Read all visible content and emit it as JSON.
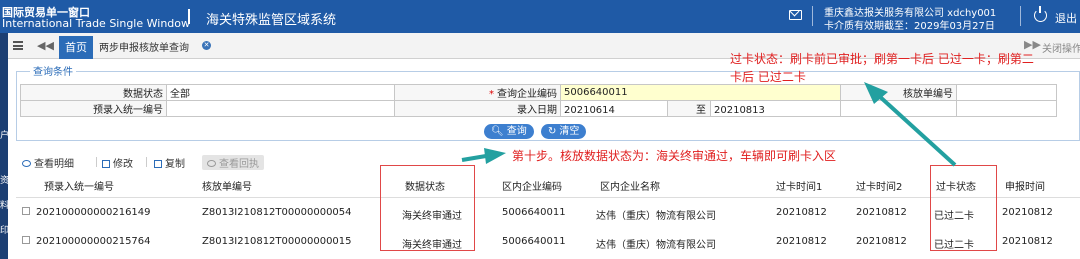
{
  "header": {
    "brand_cn": "国际贸易单一窗口",
    "brand_en": "International Trade Single Window",
    "system_title": "海关特殊监管区域系统",
    "company": "重庆鑫达报关服务有限公司 xdchy001",
    "card_validity": "卡介质有效期截至：2029年03月27日",
    "logout_label": "退出",
    "color_primary": "#1f5aa6"
  },
  "left_strip": {
    "chars": [
      "户",
      "资",
      "料",
      "印"
    ]
  },
  "tabs": {
    "home": "首页",
    "active": "两步申报核放单查询",
    "close_ops": "关闭操作"
  },
  "query": {
    "legend": "查询条件",
    "labels": {
      "data_status": "数据状态",
      "company_code": "查询企业编码",
      "release_no": "核放单编号",
      "preentry_no": "预录入统一编号",
      "entry_date": "录入日期",
      "to": "至"
    },
    "values": {
      "data_status": "全部",
      "company_code": "5006640011",
      "release_no": "",
      "preentry_no": "",
      "date_from": "20210614",
      "date_to": "20210813"
    },
    "buttons": {
      "query": "查询",
      "clear": "清空"
    }
  },
  "toolbar": {
    "view_detail": "查看明细",
    "modify": "修改",
    "copy": "复制",
    "view_receipt": "查看回执"
  },
  "grid": {
    "columns": [
      "预录入统一编号",
      "核放单编号",
      "数据状态",
      "区内企业编码",
      "区内企业名称",
      "过卡时间1",
      "过卡时间2",
      "过卡状态",
      "申报时间"
    ],
    "rows": [
      [
        "202100000000216149",
        "Z8013I210812T00000000054",
        "海关终审通过",
        "5006640011",
        "达伟（重庆）物流有限公司",
        "20210812",
        "20210812",
        "已过二卡",
        "20210812"
      ],
      [
        "202100000000215764",
        "Z8013I210812T00000000015",
        "海关终审通过",
        "5006640011",
        "达伟（重庆）物流有限公司",
        "20210812",
        "20210812",
        "已过二卡",
        "20210812"
      ]
    ]
  },
  "annotations": {
    "card_status_note_1": "过卡状态：刷卡前已审批；刷第一卡后 已过一卡；刷第二",
    "card_status_note_2": "卡后 已过二卡",
    "step_ten_note": "第十步。核放数据状态为：海关终审通过，车辆即可刷卡入区",
    "color_note": "#e02020",
    "color_arrow": "#23a0a0"
  }
}
